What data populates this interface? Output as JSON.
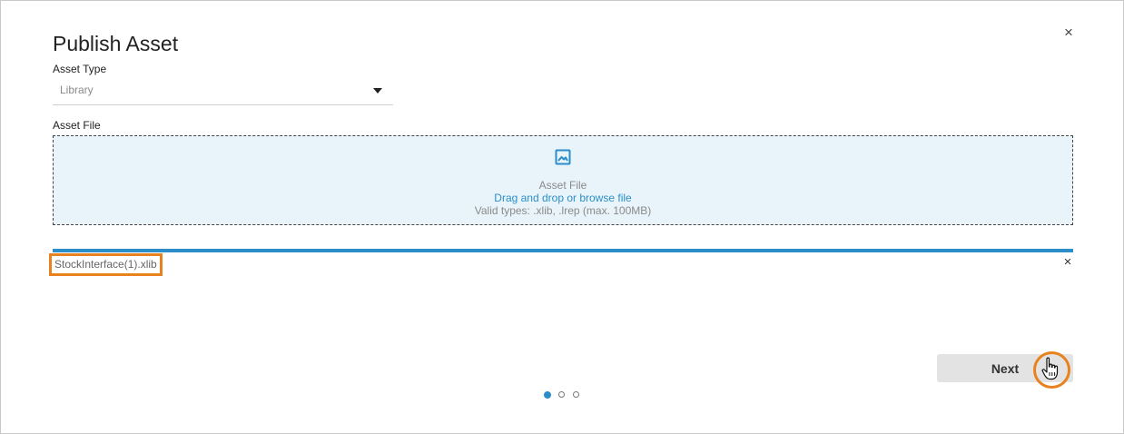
{
  "dialog": {
    "title": "Publish Asset",
    "close_symbol": "×"
  },
  "asset_type": {
    "label": "Asset Type",
    "value": "Library"
  },
  "asset_file": {
    "label": "Asset File",
    "dropzone": {
      "icon": "image-icon",
      "title": "Asset File",
      "action": "Drag and drop or browse file",
      "hint": "Valid types: .xlib, .lrep (max. 100MB)"
    }
  },
  "upload": {
    "file_name": "StockInterface(1).xlib",
    "progress": 1.0,
    "remove_symbol": "×"
  },
  "footer": {
    "next_label": "Next",
    "steps": {
      "current": 1,
      "total": 3
    }
  },
  "colors": {
    "accent": "#2b8ec9",
    "highlight": "#e8821e",
    "dropzone_bg": "#e9f4fa"
  }
}
